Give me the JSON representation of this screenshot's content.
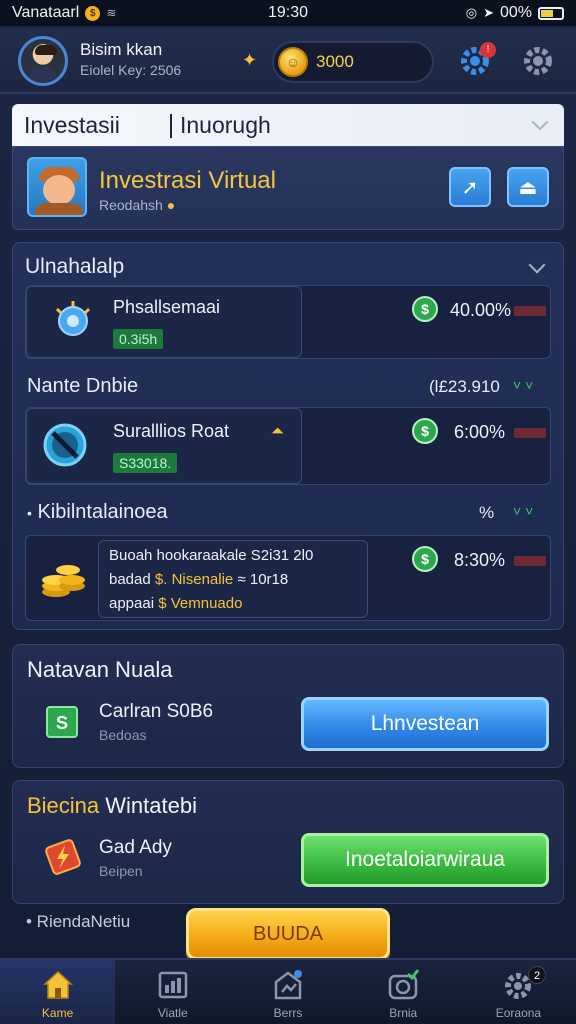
{
  "status_bar": {
    "carrier": "Vanataarl",
    "time": "19:30",
    "battery": "00%"
  },
  "profile": {
    "name": "Bisim kkan",
    "subtitle": "Eiolel Key: 2506",
    "coins": "3000"
  },
  "header": {
    "tab_left": "Investasii",
    "tab_right": "Inuorugh"
  },
  "virtual_card": {
    "title": "Investrasi Virtual",
    "subtitle": "Reodahsh"
  },
  "portfolio": {
    "title": "Ulnahalalp",
    "items": [
      {
        "name": "Phsallsemaai",
        "tag": "0.3i5h",
        "percent": "40.00%"
      }
    ],
    "group2": {
      "heading": "Nante Dnbie",
      "value": "(l£23.910"
    },
    "items2": [
      {
        "name": "Suralllios Roat",
        "tag": "S33018.",
        "percent": "6:00%"
      }
    ],
    "group3": {
      "heading": "Kibilntalainoea",
      "value": "%"
    },
    "items3": [
      {
        "line1": "Buoah hookaraakale S2i31 2l0",
        "line2_prefix": "badad",
        "line2_gold": "$. Nisenalie",
        "line2_suffix": "≈ 10r18",
        "line3_prefix": "appaai",
        "line3_gold": "$ Vemnuado",
        "percent": "8:30%"
      }
    ]
  },
  "invest_panel": {
    "title": "Natavan Nuala",
    "line1": "Carlran S0B6",
    "line2": "Bedoas",
    "button": "Lhnvestean"
  },
  "game_panel": {
    "title_gold": "Biecina",
    "title_rest": "Wintatebi",
    "line1": "Gad Ady",
    "line2": "Beipen",
    "button": "Inoetaloiarwiraua"
  },
  "bottom": {
    "label": "• RiendaNetiu",
    "button": "BUUDA"
  },
  "nav": [
    {
      "label": "Kame",
      "icon": "home-icon"
    },
    {
      "label": "Viatle",
      "icon": "chart-icon"
    },
    {
      "label": "Berrs",
      "icon": "store-icon"
    },
    {
      "label": "Brnia",
      "icon": "camera-icon"
    },
    {
      "label": "Eoraona",
      "icon": "gear-icon",
      "badge": "2"
    }
  ],
  "colors": {
    "accent_gold": "#f5c33a",
    "accent_blue": "#2f86e6",
    "accent_green": "#38b83f",
    "background": "#17223d"
  }
}
